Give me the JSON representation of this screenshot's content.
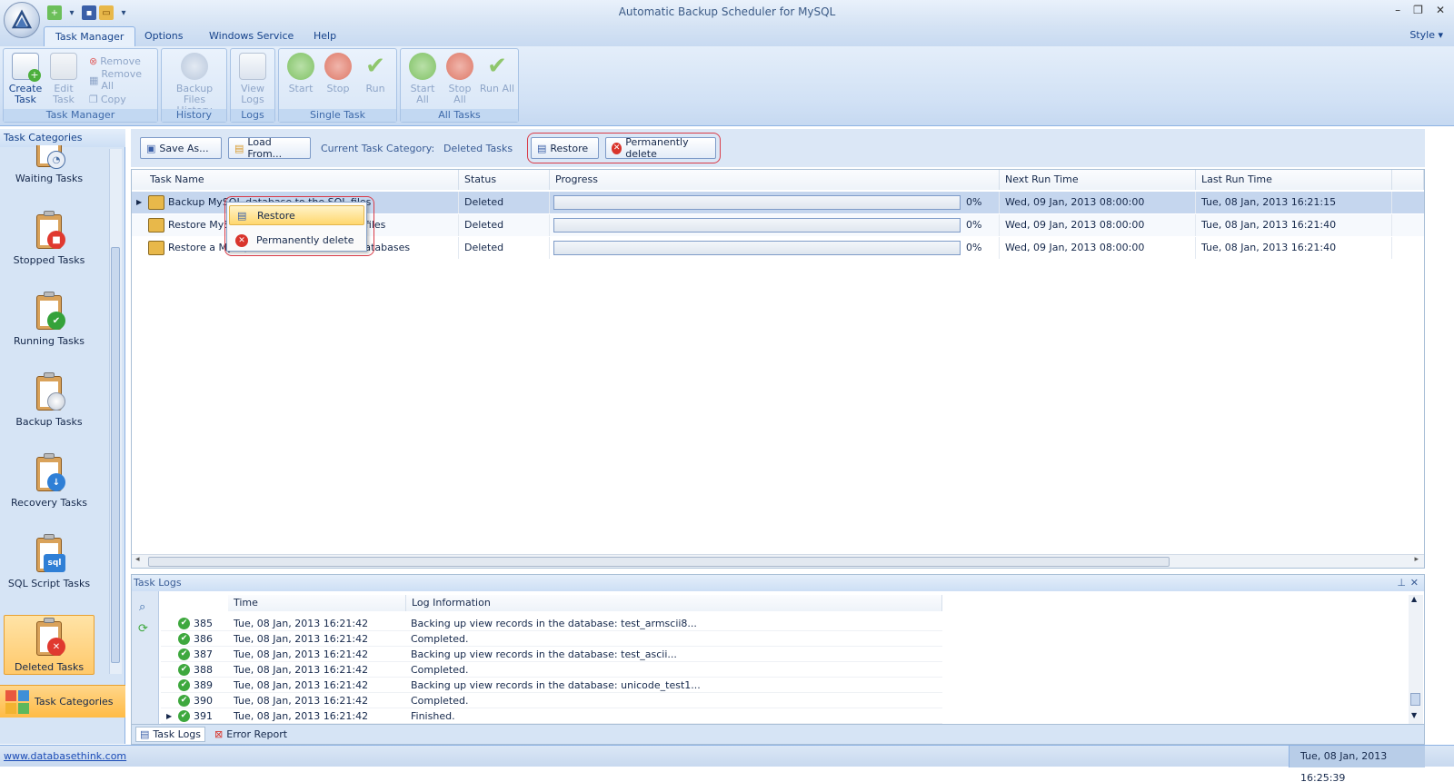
{
  "window": {
    "title": "Automatic Backup Scheduler for MySQL"
  },
  "tabs": [
    {
      "label": "Task Manager"
    },
    {
      "label": "Options"
    },
    {
      "label": "Windows Service"
    },
    {
      "label": "Help"
    }
  ],
  "style_menu": "Style",
  "ribbon": {
    "task_manager": {
      "group_label": "Task Manager",
      "create_task": "Create Task",
      "edit_task": "Edit Task",
      "remove": "Remove",
      "remove_all": "Remove All",
      "copy": "Copy"
    },
    "history": {
      "group_label": "History",
      "backup_files_history": "Backup Files History"
    },
    "logs": {
      "group_label": "Logs",
      "view_logs": "View Logs"
    },
    "single_task": {
      "group_label": "Single Task",
      "start": "Start",
      "stop": "Stop",
      "run": "Run"
    },
    "all_tasks": {
      "group_label": "All Tasks",
      "start_all": "Start All",
      "stop_all": "Stop All",
      "run_all": "Run All"
    }
  },
  "left_panel": {
    "header": "Task Categories",
    "categories": [
      {
        "label": "Waiting Tasks",
        "icon": "clock-icon"
      },
      {
        "label": "Stopped Tasks",
        "icon": "stop-icon"
      },
      {
        "label": "Running Tasks",
        "icon": "check-icon"
      },
      {
        "label": "Backup Tasks",
        "icon": "disc-icon"
      },
      {
        "label": "Recovery Tasks",
        "icon": "recover-icon"
      },
      {
        "label": "SQL Script Tasks",
        "icon": "sql-icon"
      },
      {
        "label": "Deleted Tasks",
        "icon": "delete-icon"
      }
    ],
    "bottom_button": "Task Categories"
  },
  "toolbar": {
    "save_as": "Save As...",
    "load_from": "Load From...",
    "current_category_label": "Current Task Category:",
    "current_category_value": "Deleted Tasks",
    "restore": "Restore",
    "permanently_delete": "Permanently delete"
  },
  "grid": {
    "columns": [
      "Task Name",
      "Status",
      "Progress",
      "Next Run Time",
      "Last Run Time"
    ],
    "rows": [
      {
        "name": "Backup MySQL database to the SQL files",
        "status": "Deleted",
        "progress": "0%",
        "progress_fraction": 0,
        "next_run": "Wed, 09 Jan, 2013 08:00:00",
        "last_run": "Tue, 08 Jan, 2013 16:21:15"
      },
      {
        "name": "Restore MySQL database from the SQL files",
        "status": "Deleted",
        "progress": "0%",
        "progress_fraction": 0,
        "next_run": "Wed, 09 Jan, 2013 08:00:00",
        "last_run": "Tue, 08 Jan, 2013 16:21:40"
      },
      {
        "name": "Restore a MySQL database to several databases",
        "status": "Deleted",
        "progress": "0%",
        "progress_fraction": 0,
        "next_run": "Wed, 09 Jan, 2013 08:00:00",
        "last_run": "Tue, 08 Jan, 2013 16:21:40"
      }
    ]
  },
  "context_menu": {
    "restore": "Restore",
    "permanently_delete": "Permanently delete"
  },
  "task_logs": {
    "header": "Task Logs",
    "columns": [
      "Time",
      "Log Information"
    ],
    "rows": [
      {
        "id": "385",
        "time": "Tue, 08 Jan, 2013 16:21:42",
        "info": "Backing up view records in the database: test_armscii8..."
      },
      {
        "id": "386",
        "time": "Tue, 08 Jan, 2013 16:21:42",
        "info": "Completed."
      },
      {
        "id": "387",
        "time": "Tue, 08 Jan, 2013 16:21:42",
        "info": "Backing up view records in the database: test_ascii..."
      },
      {
        "id": "388",
        "time": "Tue, 08 Jan, 2013 16:21:42",
        "info": "Completed."
      },
      {
        "id": "389",
        "time": "Tue, 08 Jan, 2013 16:21:42",
        "info": "Backing up view records in the database: unicode_test1..."
      },
      {
        "id": "390",
        "time": "Tue, 08 Jan, 2013 16:21:42",
        "info": "Completed."
      },
      {
        "id": "391",
        "time": "Tue, 08 Jan, 2013 16:21:42",
        "info": "Finished."
      }
    ],
    "tab_task_logs": "Task Logs",
    "tab_error_report": "Error Report"
  },
  "status_bar": {
    "link": "www.databasethink.com",
    "time": "Tue, 08 Jan, 2013 16:25:39"
  },
  "colors": {
    "accent": "#15428b",
    "highlight": "#ffd76e",
    "callout": "#d93b48"
  }
}
